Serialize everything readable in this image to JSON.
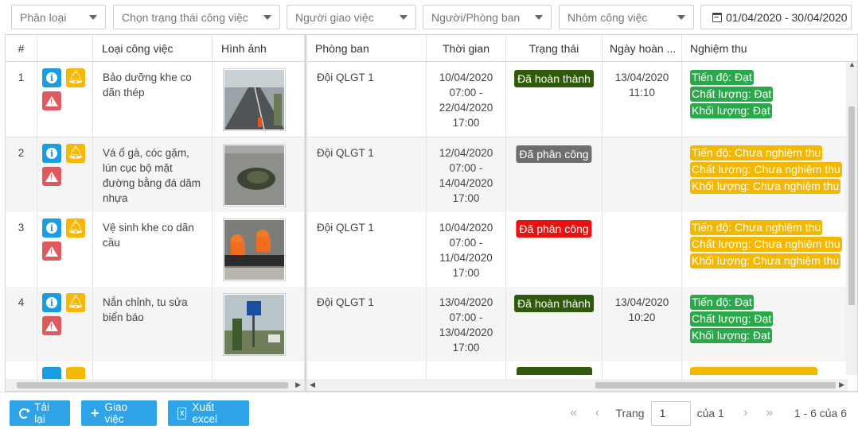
{
  "filters": {
    "category": "Phân loại",
    "job_status": "Chọn trạng thái công việc",
    "assigner": "Người giao việc",
    "assignee": "Người/Phòng ban",
    "job_group": "Nhóm công việc",
    "date_range": "01/04/2020 - 30/04/2020"
  },
  "table": {
    "headers": {
      "index": "#",
      "actions": "",
      "job_type": "Loại công việc",
      "image": "Hình ảnh",
      "department": "Phòng ban",
      "time": "Thời gian",
      "status": "Trạng thái",
      "completed_date": "Ngày hoàn ...",
      "acceptance": "Nghiệm thu"
    },
    "rows": [
      {
        "index": "1",
        "job_type": "Bảo dưỡng khe co dãn thép",
        "department": "Đội QLGT 1",
        "time": "10/04/2020\n07:00 -\n22/04/2020\n17:00",
        "status": "Đã hoàn thành",
        "completed_date": "13/04/2020\n11:10",
        "acceptance": [
          "Tiến độ: Đạt",
          "Chất lượng: Đạt",
          "Khối lượng: Đạt"
        ]
      },
      {
        "index": "2",
        "job_type": "Vá ổ gà, cóc gặm, lún cục bộ mặt đường bằng đá dăm nhựa",
        "department": "Đội QLGT 1",
        "time": "12/04/2020\n07:00 -\n14/04/2020\n17:00",
        "status": "Đã phân công",
        "completed_date": "",
        "acceptance": [
          "Tiến độ: Chưa nghiệm thu",
          "Chất lượng: Chưa nghiệm thu",
          "Khối lượng: Chưa nghiệm thu"
        ]
      },
      {
        "index": "3",
        "job_type": "Vệ sinh khe co dãn cầu",
        "department": "Đội QLGT 1",
        "time": "10/04/2020\n07:00 -\n11/04/2020\n17:00",
        "status": "Đã phân công",
        "completed_date": "",
        "acceptance": [
          "Tiến độ: Chưa nghiệm thu",
          "Chất lượng: Chưa nghiệm thu",
          "Khối lượng: Chưa nghiệm thu"
        ]
      },
      {
        "index": "4",
        "job_type": "Nắn chỉnh, tu sửa biển báo",
        "department": "Đội QLGT 1",
        "time": "13/04/2020\n07:00 -\n13/04/2020\n17:00",
        "status": "Đã hoàn thành",
        "completed_date": "13/04/2020\n10:20",
        "acceptance": [
          "Tiến độ: Đạt",
          "Chất lượng: Đạt",
          "Khối lượng: Đạt"
        ]
      }
    ]
  },
  "colors": {
    "done": "#2e5a0a",
    "assigned": "#6e6e6e",
    "assigned_red": "#e81212",
    "accept_ok": "#2ba84a",
    "accept_pending": "#f5b800",
    "button": "#2ea3e8"
  },
  "footer": {
    "reload_label": "Tải lại",
    "assign_label": "Giao việc",
    "export_label": "Xuất excel",
    "page_label": "Trang",
    "page_value": "1",
    "of_label": "của 1",
    "range_info": "1 - 6 của 6"
  }
}
